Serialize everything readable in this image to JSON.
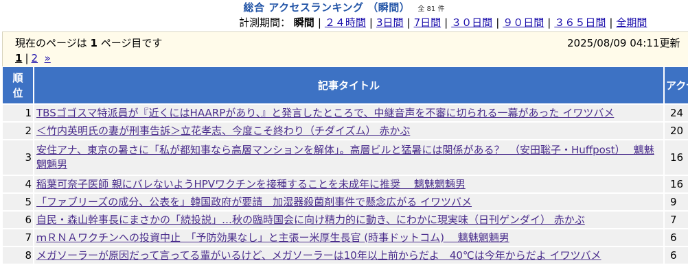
{
  "header": {
    "title": "総合 アクセスランキング （瞬間）",
    "total": "全 81 件"
  },
  "period": {
    "label": "計測期間：",
    "current": "瞬間",
    "options": [
      "２４時間",
      "3日間",
      "7日間",
      "３０日間",
      "９０日間",
      "３６５日間",
      "全期間"
    ]
  },
  "status": {
    "prefix": "現在のページは",
    "page": "1",
    "suffix": "ページ目です",
    "updated": "2025/08/09 04:11更新"
  },
  "pager": {
    "current": "1",
    "next_page": "2",
    "next_arrow": "»"
  },
  "table": {
    "col_rank": "順位",
    "col_title": "記事タイトル",
    "col_access": "アクセス",
    "rows": [
      {
        "rank": "1",
        "title": "TBSゴゴスマ特派員が『近くにはHAARPがあり、』と発言したところで、中継音声を不審に切られる一幕があった イワツバメ",
        "count": "24"
      },
      {
        "rank": "2",
        "title": "＜竹内英明氏の妻が刑事告訴＞立花孝志、今度こそ終わり（チダイズム） 赤かぶ",
        "count": "20"
      },
      {
        "rank": "3",
        "title": "安住アナ、東京の暑さに「私が都知事なら高層マンションを解体」。高層ビルと猛暑には関係がある？　（安田聡子・Huffpost）　 魑魅魍魎男",
        "count": "16"
      },
      {
        "rank": "4",
        "title": "稲葉可奈子医師 親にバレないようHPVワクチンを接種することを未成年に推奨　 魑魅魍魎男",
        "count": "16"
      },
      {
        "rank": "5",
        "title": "「ファブリーズの成分、公表を」韓国政府が要請　加湿器殺菌剤事件で懸念広がる イワツバメ",
        "count": "9"
      },
      {
        "rank": "6",
        "title": "自民・森山幹事長にまさかの「続投説」…秋の臨時国会に向け精力的に動き、にわかに現実味（日刊ゲンダイ） 赤かぶ",
        "count": "7"
      },
      {
        "rank": "7",
        "title": "ｍＲＮＡワクチンへの投資中止　「予防効果なし」と主張ー米厚生長官 (時事ドットコム)　 魑魅魍魎男",
        "count": "6"
      },
      {
        "rank": "8",
        "title": "メガソーラーが原因だって言ってる輩がいるけど、メガソーラーは10年以上前からだよ　40℃は今年からだよ イワツバメ",
        "count": "6"
      }
    ]
  }
}
